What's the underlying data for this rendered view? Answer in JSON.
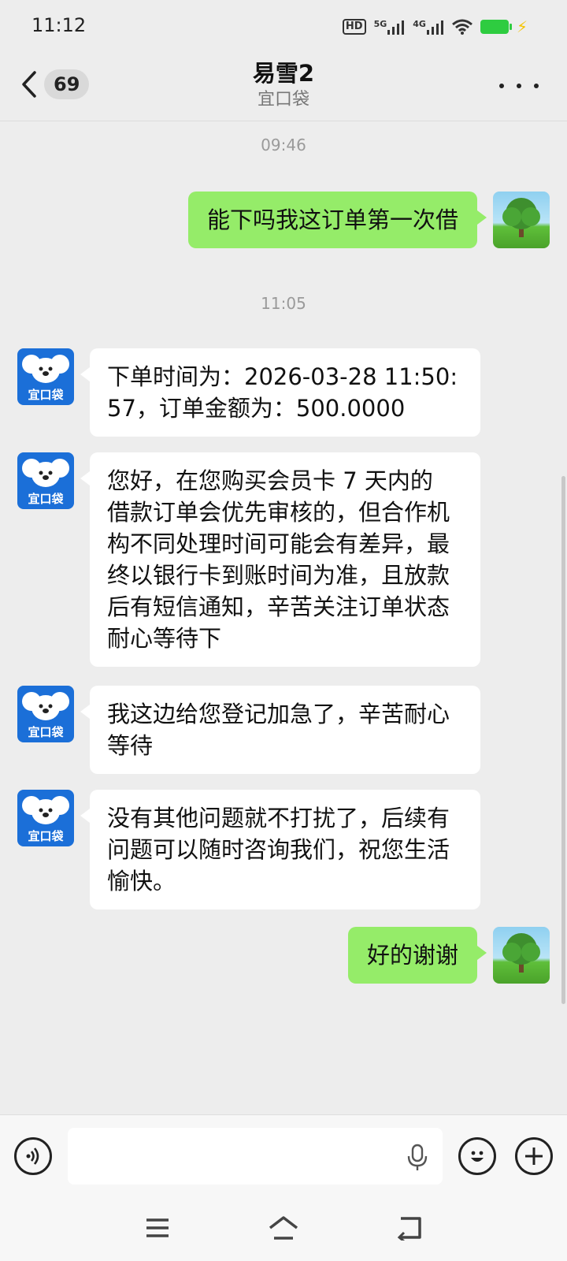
{
  "status_bar": {
    "time": "11:12",
    "hd": "HD",
    "net1": "5G",
    "net2": "4G"
  },
  "header": {
    "unread_count": "69",
    "title": "易雪2",
    "subtitle": "宜口袋"
  },
  "bot_avatar_text": "宜口袋",
  "messages": [
    {
      "type": "time",
      "text": "09:46"
    },
    {
      "type": "out",
      "text": "能下吗我这订单第一次借"
    },
    {
      "type": "time",
      "text": "11:05"
    },
    {
      "type": "in",
      "lines": [
        "下单时间为：2026-03-28 11:50:",
        "57，订单金额为：500.0000"
      ]
    },
    {
      "type": "in",
      "lines": [
        "您好，在您购买会员卡 7 天内的",
        "借款订单会优先审核的，但合作机",
        "构不同处理时间可能会有差异，最",
        "终以银行卡到账时间为准，且放款",
        "后有短信通知，辛苦关注订单状态",
        "耐心等待下"
      ]
    },
    {
      "type": "in",
      "lines": [
        "我这边给您登记加急了，辛苦耐心",
        "等待"
      ]
    },
    {
      "type": "in",
      "lines": [
        "没有其他问题就不打扰了，后续有",
        "问题可以随时咨询我们，祝您生活",
        "愉快。"
      ]
    },
    {
      "type": "out",
      "text": "好的谢谢"
    }
  ],
  "input": {
    "value": "",
    "placeholder": ""
  },
  "icons": {
    "back": "chevron-left-icon",
    "more": "more-dots-icon",
    "voice": "voice-icon",
    "mic": "microphone-icon",
    "emoji": "emoji-icon",
    "add": "plus-icon",
    "nav_menu": "menu-icon",
    "nav_home": "home-icon",
    "nav_back": "back-icon"
  },
  "colors": {
    "outgoing_bubble": "#95ec69",
    "incoming_bubble": "#ffffff",
    "background": "#ededed",
    "bot_avatar": "#1b6fd8"
  }
}
